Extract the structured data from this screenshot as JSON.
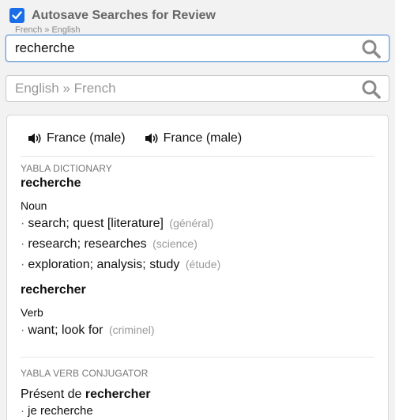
{
  "autosave": {
    "label": "Autosave Searches for Review",
    "checked": true
  },
  "search_fr_en": {
    "lang_hint": "French » English",
    "value": "recherche"
  },
  "search_en_fr": {
    "placeholder": "English » French"
  },
  "audio": [
    {
      "label": "France (male)",
      "icon": "speaker-icon"
    },
    {
      "label": "France (male)",
      "icon": "speaker-icon"
    }
  ],
  "dictionary": {
    "section_title": "YABLA DICTIONARY",
    "entries": [
      {
        "headword": "recherche",
        "pos": "Noun",
        "senses": [
          {
            "text": "search; quest [literature]",
            "domain": "(général)"
          },
          {
            "text": "research; researches",
            "domain": "(science)"
          },
          {
            "text": "exploration; analysis; study",
            "domain": "(étude)"
          }
        ]
      },
      {
        "headword": "rechercher",
        "pos": "Verb",
        "senses": [
          {
            "text": "want; look for",
            "domain": "(criminel)"
          }
        ]
      }
    ]
  },
  "conjugator": {
    "section_title": "YABLA VERB CONJUGATOR",
    "title_prefix": "Présent de",
    "title_verb": "rechercher",
    "rows": [
      {
        "pronoun": "je",
        "form": "recherche"
      }
    ]
  },
  "colors": {
    "accent": "#1a6ee8",
    "muted": "#999999"
  }
}
